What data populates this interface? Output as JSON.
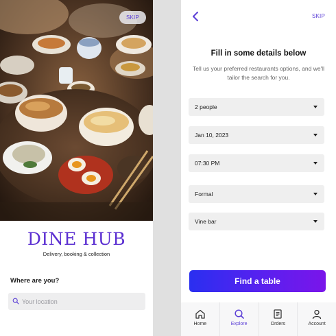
{
  "left_screen": {
    "skip_label": "SKIP",
    "brand": "DINE HUB",
    "tagline": "Delivery, booking & collection",
    "location_prompt": "Where are you?",
    "location_input": {
      "value": "",
      "placeholder": "Your location"
    }
  },
  "right_screen": {
    "skip_label": "SKIP",
    "title": "Fill in some details below",
    "subtitle": "Tell us your preferred restaurants options, and we'll tailor the search for you.",
    "fields": {
      "party_size": "2 people",
      "date": "Jan 10, 2023",
      "time": "07:30 PM",
      "dress_code": "Formal",
      "venue_type": "Vine bar"
    },
    "cta_label": "Find a table",
    "tabs": [
      {
        "label": "Home",
        "icon": "home-icon",
        "active": false
      },
      {
        "label": "Explore",
        "icon": "search-icon",
        "active": true
      },
      {
        "label": "Orders",
        "icon": "receipt-icon",
        "active": false
      },
      {
        "label": "Account",
        "icon": "user-icon",
        "active": false
      }
    ]
  },
  "colors": {
    "accent": "#5b3fd6",
    "brand": "#5b2fd1",
    "cta_gradient_start": "#2a2ff0",
    "cta_gradient_end": "#7a15ea",
    "field_bg": "#efefef",
    "divider_bg": "#e0e0e0"
  }
}
